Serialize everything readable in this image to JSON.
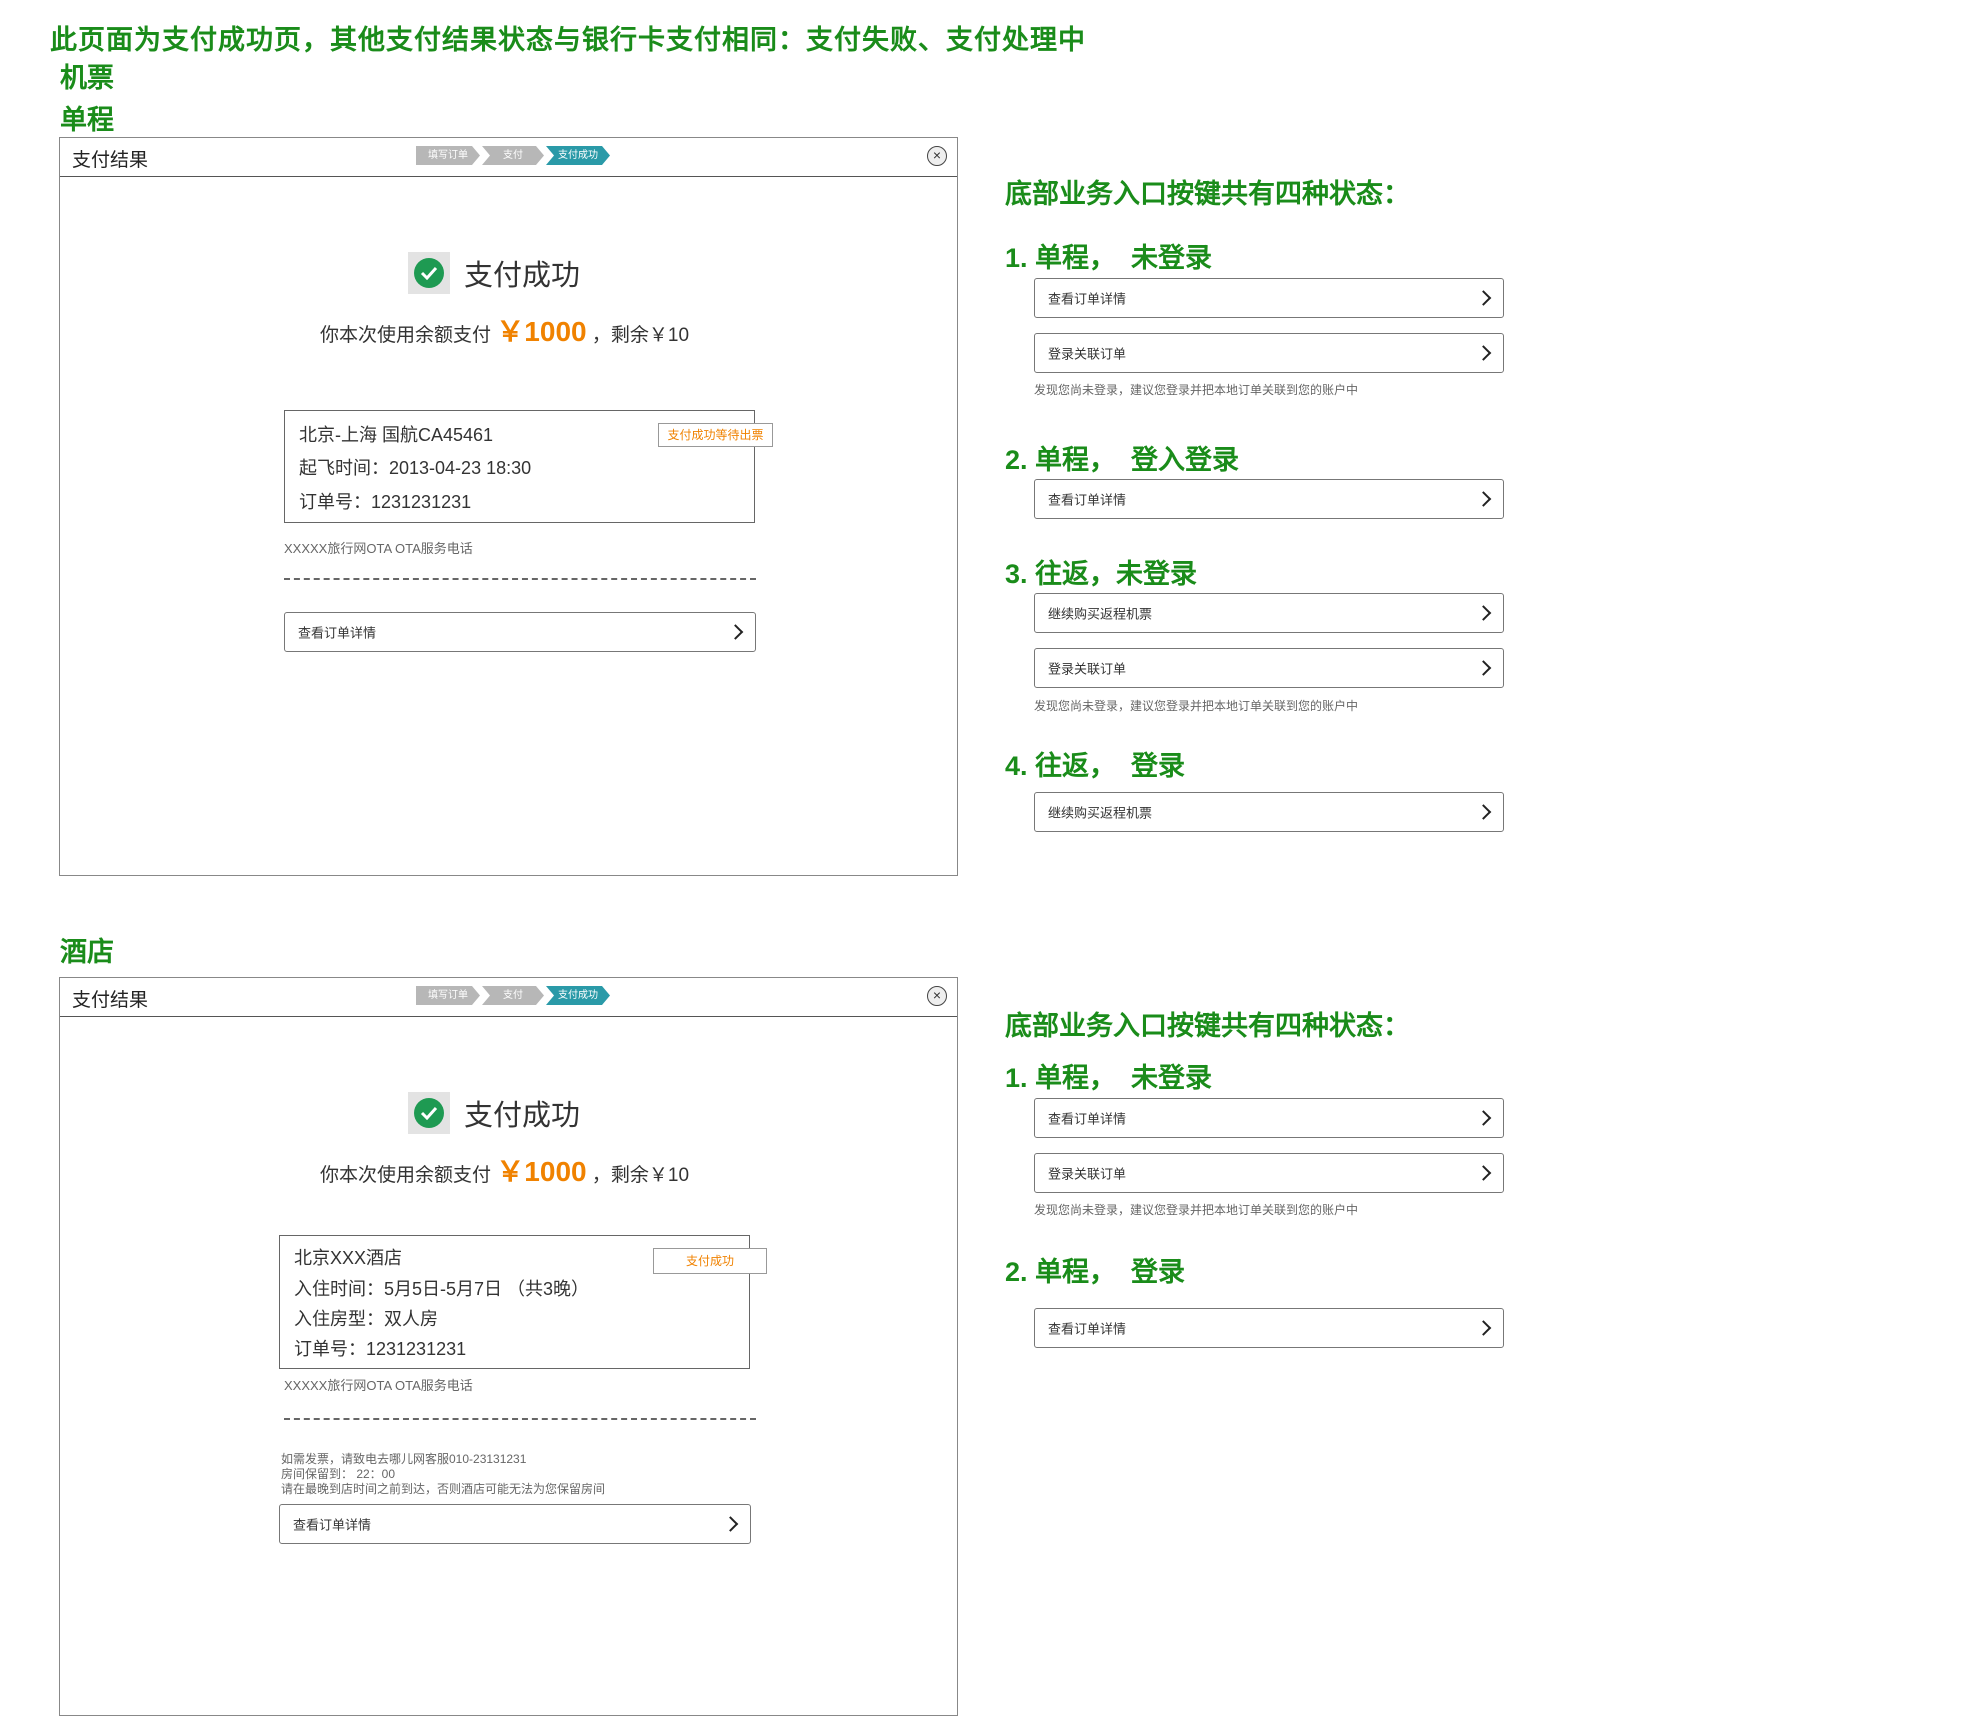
{
  "header_note": "此页面为支付成功页，其他支付结果状态与银行卡支付相同：支付失败、支付处理中",
  "category_flight": "机票",
  "section_oneway": "单程",
  "section_hotel": "酒店",
  "panel": {
    "title": "支付结果",
    "steps": [
      "填写订单",
      "支付",
      "支付成功"
    ],
    "success_text": "支付成功",
    "pay_prefix": "你本次使用余额支付",
    "pay_amount": "￥1000",
    "pay_suffix": "，剩余￥10",
    "ota_text": "XXXXX旅行网OTA    OTA服务电话",
    "detail_button": "查看订单详情"
  },
  "flight": {
    "route": "北京-上海   国航CA45461",
    "departure": "起飞时间：2013-04-23 18:30",
    "order_no": "订单号：1231231231",
    "status": "支付成功等待出票"
  },
  "hotel": {
    "name": "北京XXX酒店",
    "checkin": "入住时间：5月5日-5月7日   （共3晚）",
    "room": "入住房型：双人房",
    "order_no": "订单号：1231231231",
    "status": "支付成功",
    "notes": [
      "如需发票，请致电去哪儿网客服010-23131231",
      "房间保留到：   22：00",
      "请在最晚到店时间之前到达，否则酒店可能无法为您保留房间"
    ]
  },
  "right_flight": {
    "heading": "底部业务入口按键共有四种状态：",
    "states": [
      {
        "title": "1. 单程，  未登录",
        "buttons": [
          "查看订单详情",
          "登录关联订单"
        ],
        "hint": "发现您尚未登录，建议您登录并把本地订单关联到您的账户中"
      },
      {
        "title": "2. 单程，  登入登录",
        "buttons": [
          "查看订单详情"
        ],
        "hint": ""
      },
      {
        "title": "3. 往返，未登录",
        "buttons": [
          "继续购买返程机票",
          "登录关联订单"
        ],
        "hint": "发现您尚未登录，建议您登录并把本地订单关联到您的账户中"
      },
      {
        "title": "4. 往返，  登录",
        "buttons": [
          "继续购买返程机票"
        ],
        "hint": ""
      }
    ]
  },
  "right_hotel": {
    "heading": "底部业务入口按键共有四种状态：",
    "states": [
      {
        "title": "1. 单程，  未登录",
        "buttons": [
          "查看订单详情",
          "登录关联订单"
        ],
        "hint": "发现您尚未登录，建议您登录并把本地订单关联到您的账户中"
      },
      {
        "title": "2. 单程，  登录",
        "buttons": [
          "查看订单详情"
        ],
        "hint": ""
      }
    ]
  }
}
